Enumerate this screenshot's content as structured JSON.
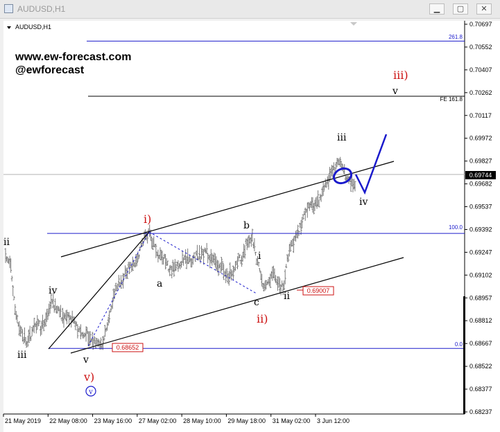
{
  "window": {
    "title": "AUDUSD,H1"
  },
  "chart_data": {
    "type": "line",
    "symbol_label": "AUDUSD,H1",
    "watermark": [
      "www.ew-forecast.com",
      "@ewforecast"
    ],
    "ylim": [
      0.68237,
      0.70697
    ],
    "price_ticks": [
      "0.70697",
      "0.70552",
      "0.70407",
      "0.70262",
      "0.70117",
      "0.69972",
      "0.69827",
      "0.69682",
      "0.69537",
      "0.69392",
      "0.69247",
      "0.69102",
      "0.68957",
      "0.68812",
      "0.68667",
      "0.68522",
      "0.68377",
      "0.68237"
    ],
    "time_ticks": [
      "21 May 2019",
      "22 May 08:00",
      "23 May 16:00",
      "27 May 02:00",
      "28 May 10:00",
      "29 May 18:00",
      "31 May 02:00",
      "3 Jun 12:00"
    ],
    "current_price": "0.69744",
    "fibonacci_levels": [
      {
        "label": "261.8",
        "price": 0.7059
      },
      {
        "label": "100.0",
        "price": 0.6937
      },
      {
        "label": "0.0",
        "price": 0.6864
      }
    ],
    "extension_level": {
      "label": "FE 161.8",
      "price": 0.7024
    },
    "price_labels": [
      {
        "text": "0.69007",
        "price": 0.6901
      },
      {
        "text": "0.68652",
        "price": 0.6864
      }
    ],
    "price_path": [
      0.6925,
      0.6915,
      0.6885,
      0.6875,
      0.6868,
      0.6872,
      0.688,
      0.6877,
      0.6885,
      0.6895,
      0.6888,
      0.6884,
      0.6883,
      0.6882,
      0.6876,
      0.6872,
      0.6873,
      0.6868,
      0.6865,
      0.6867,
      0.6884,
      0.6897,
      0.6905,
      0.691,
      0.6915,
      0.6917,
      0.6925,
      0.6933,
      0.6937,
      0.6928,
      0.6922,
      0.692,
      0.6913,
      0.6915,
      0.6918,
      0.6922,
      0.6918,
      0.6924,
      0.6922,
      0.6926,
      0.692,
      0.6918,
      0.6916,
      0.691,
      0.6912,
      0.6918,
      0.6922,
      0.6932,
      0.6935,
      0.6918,
      0.6906,
      0.6903,
      0.6913,
      0.6906,
      0.6902,
      0.6923,
      0.6932,
      0.6936,
      0.695,
      0.6955,
      0.6953,
      0.6958,
      0.6965,
      0.6972,
      0.6978,
      0.6983,
      0.6975,
      0.697,
      0.6965
    ],
    "wave_labels": [
      {
        "text": "ii",
        "color": "black"
      },
      {
        "text": "iii",
        "color": "black"
      },
      {
        "text": "iv",
        "color": "black"
      },
      {
        "text": "v",
        "color": "black"
      },
      {
        "text": "v)",
        "color": "red"
      },
      {
        "text": "v",
        "color": "blue",
        "circled": true
      },
      {
        "text": "i)",
        "color": "red"
      },
      {
        "text": "a",
        "color": "black"
      },
      {
        "text": "b",
        "color": "black"
      },
      {
        "text": "c",
        "color": "black"
      },
      {
        "text": "ii)",
        "color": "red"
      },
      {
        "text": "i",
        "color": "black"
      },
      {
        "text": "ii",
        "color": "black"
      },
      {
        "text": "iii",
        "color": "black"
      },
      {
        "text": "iv",
        "color": "black"
      },
      {
        "text": "iii)",
        "color": "red"
      },
      {
        "text": "v",
        "color": "black"
      }
    ],
    "colors": {
      "fib": "#1c1ccc",
      "price_label": "#cc1111",
      "projection": "#1a1acc",
      "bars": "#7a7a7a"
    }
  }
}
